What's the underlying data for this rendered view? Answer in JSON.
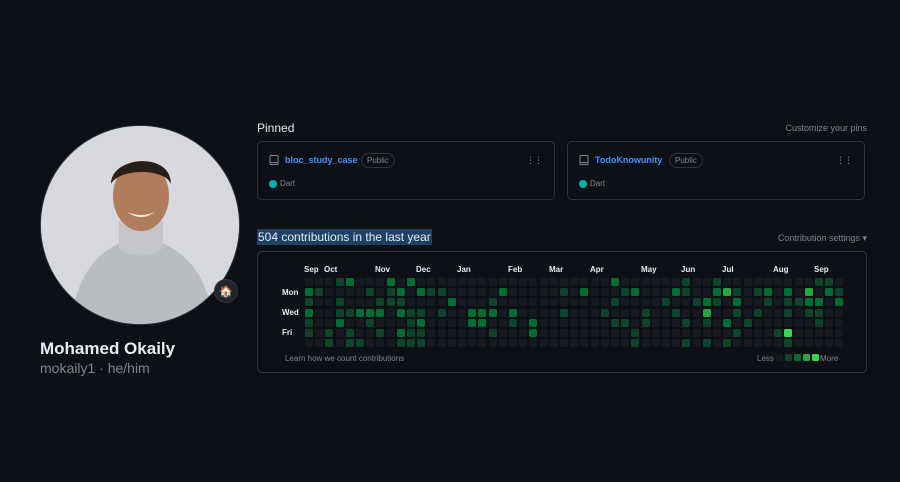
{
  "profile": {
    "name": "Mohamed Okaily",
    "login": "mokaily1",
    "separator": "·",
    "pronouns": "he/him",
    "status_emoji": "🏠"
  },
  "pinned": {
    "title": "Pinned",
    "customize_label": "Customize your pins",
    "repos": [
      {
        "name": "bloc_study_case",
        "visibility": "Public",
        "language": "Dart",
        "language_color": "#00b4ab"
      },
      {
        "name": "TodoKnowunity",
        "visibility": "Public",
        "language": "Dart",
        "language_color": "#00b4ab"
      }
    ]
  },
  "contributions": {
    "title": "504 contributions in the last year",
    "settings_label": "Contribution settings ▾",
    "months": [
      "Sep",
      "Oct",
      "Nov",
      "Dec",
      "Jan",
      "Feb",
      "Mar",
      "Apr",
      "May",
      "Jun",
      "Jul",
      "Aug",
      "Sep"
    ],
    "days": [
      "Mon",
      "Wed",
      "Fri"
    ],
    "learn_label": "Learn how we count contributions",
    "legend_less": "Less",
    "legend_more": "More",
    "colors": [
      "#161b22",
      "#0e4429",
      "#006d32",
      "#26a641",
      "#39d353"
    ],
    "weeks": [
      [
        0,
        2,
        1,
        2,
        1,
        1,
        0
      ],
      [
        0,
        1,
        0,
        0,
        0,
        0,
        0
      ],
      [
        0,
        0,
        0,
        0,
        0,
        1,
        1
      ],
      [
        1,
        0,
        1,
        1,
        2,
        0,
        0
      ],
      [
        2,
        0,
        0,
        1,
        0,
        1,
        1
      ],
      [
        0,
        0,
        0,
        2,
        0,
        0,
        1
      ],
      [
        0,
        1,
        0,
        2,
        1,
        0,
        0
      ],
      [
        0,
        0,
        1,
        2,
        0,
        1,
        0
      ],
      [
        2,
        1,
        1,
        0,
        0,
        0,
        0
      ],
      [
        0,
        2,
        1,
        2,
        0,
        2,
        1
      ],
      [
        2,
        0,
        0,
        1,
        1,
        1,
        1
      ],
      [
        0,
        2,
        0,
        1,
        2,
        1,
        1
      ],
      [
        0,
        1,
        0,
        0,
        0,
        0,
        0
      ],
      [
        0,
        1,
        0,
        1,
        0,
        0,
        0
      ],
      [
        0,
        0,
        2,
        0,
        0,
        0,
        0
      ],
      [
        0,
        0,
        0,
        0,
        0,
        0,
        0
      ],
      [
        0,
        0,
        0,
        2,
        2,
        0,
        0
      ],
      [
        0,
        0,
        0,
        2,
        2,
        0,
        0
      ],
      [
        0,
        0,
        1,
        2,
        0,
        1,
        0
      ],
      [
        0,
        2,
        0,
        0,
        0,
        0,
        0
      ],
      [
        0,
        0,
        0,
        2,
        1,
        0,
        0
      ],
      [
        0,
        0,
        0,
        0,
        0,
        0,
        0
      ],
      [
        0,
        0,
        0,
        0,
        2,
        2,
        0
      ],
      [
        0,
        0,
        0,
        0,
        0,
        0,
        0
      ],
      [
        0,
        0,
        0,
        0,
        0,
        0,
        0
      ],
      [
        0,
        1,
        0,
        1,
        0,
        0,
        0
      ],
      [
        0,
        0,
        0,
        0,
        0,
        0,
        0
      ],
      [
        0,
        2,
        0,
        0,
        0,
        0,
        0
      ],
      [
        0,
        0,
        0,
        0,
        0,
        0,
        0
      ],
      [
        0,
        0,
        0,
        1,
        0,
        0,
        0
      ],
      [
        2,
        0,
        1,
        0,
        1,
        0,
        0
      ],
      [
        0,
        1,
        0,
        0,
        1,
        0,
        0
      ],
      [
        0,
        2,
        0,
        0,
        0,
        1,
        1
      ],
      [
        0,
        0,
        0,
        1,
        1,
        0,
        0
      ],
      [
        0,
        0,
        0,
        0,
        0,
        0,
        0
      ],
      [
        0,
        0,
        1,
        0,
        0,
        0,
        0
      ],
      [
        0,
        2,
        0,
        1,
        0,
        0,
        0
      ],
      [
        1,
        1,
        0,
        0,
        1,
        0,
        1
      ],
      [
        0,
        0,
        1,
        0,
        0,
        0,
        0
      ],
      [
        0,
        0,
        2,
        3,
        1,
        0,
        1
      ],
      [
        1,
        2,
        1,
        0,
        0,
        0,
        0
      ],
      [
        0,
        3,
        0,
        0,
        2,
        0,
        1
      ],
      [
        0,
        1,
        2,
        1,
        0,
        1,
        0
      ],
      [
        0,
        0,
        0,
        0,
        1,
        0,
        0
      ],
      [
        0,
        1,
        0,
        1,
        0,
        0,
        0
      ],
      [
        0,
        2,
        1,
        0,
        0,
        0,
        0
      ],
      [
        0,
        0,
        0,
        0,
        0,
        1,
        0
      ],
      [
        0,
        2,
        1,
        1,
        0,
        4,
        1
      ],
      [
        0,
        0,
        1,
        0,
        0,
        0,
        0
      ],
      [
        0,
        3,
        2,
        1,
        0,
        0,
        0
      ],
      [
        1,
        0,
        2,
        1,
        1,
        0,
        0
      ],
      [
        1,
        2,
        0,
        0,
        0,
        0,
        0
      ],
      [
        0,
        1,
        2,
        0,
        0,
        0,
        0
      ]
    ]
  }
}
